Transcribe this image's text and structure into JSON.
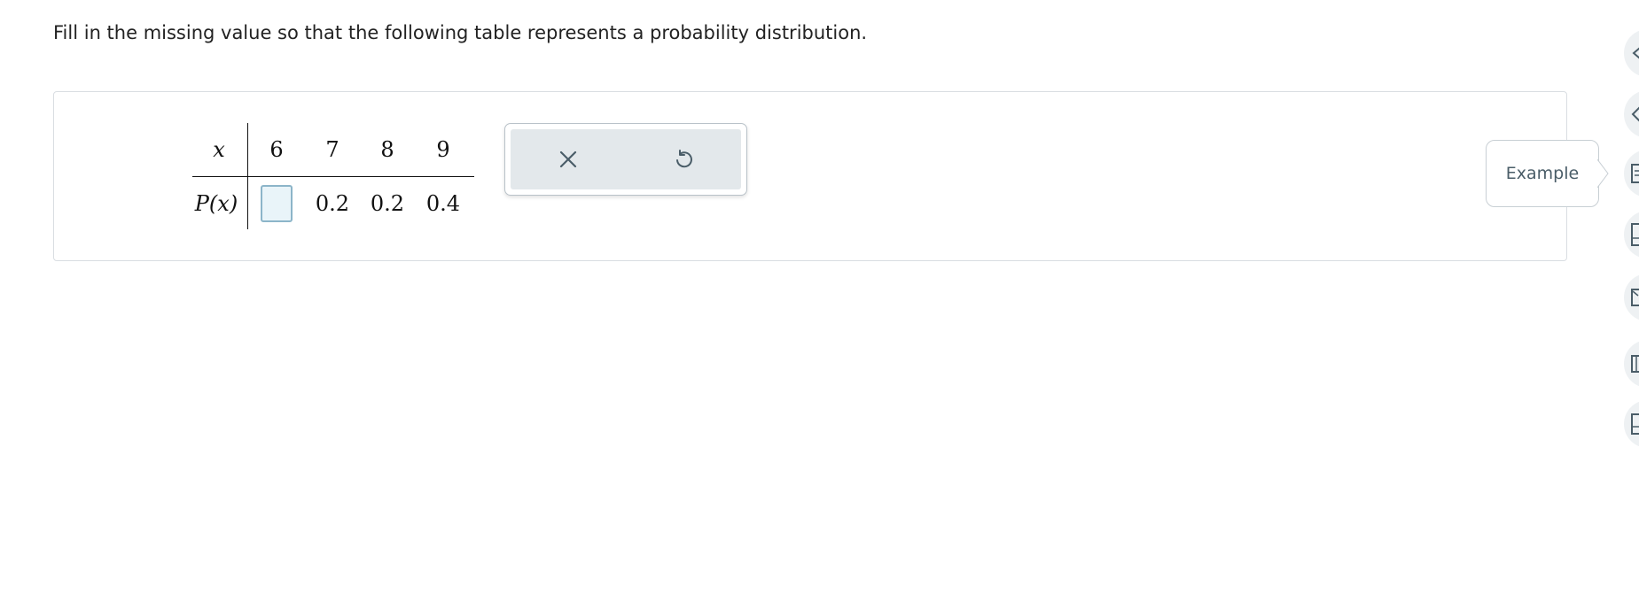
{
  "question": {
    "text": "Fill in the missing value so that the following table represents a probability distribution."
  },
  "table": {
    "row1_header": "x",
    "row2_header": "P(x)",
    "x_values": [
      "6",
      "7",
      "8",
      "9"
    ],
    "p_values": [
      "0.2",
      "0.2",
      "0.4"
    ],
    "missing_input": {
      "value": ""
    }
  },
  "tools": {
    "clear_icon": "close-icon",
    "undo_icon": "undo-icon"
  },
  "example": {
    "label": "Example"
  },
  "rail": {
    "icons": [
      "rail-icon-1",
      "rail-icon-2",
      "rail-icon-3",
      "rail-icon-4",
      "rail-icon-5",
      "rail-icon-6",
      "rail-icon-7"
    ]
  },
  "colors": {
    "accent": "#4a5d68",
    "input_fill": "#e9f4f9",
    "input_border": "#8cb5c9",
    "tool_bg": "#e3e8eb"
  }
}
